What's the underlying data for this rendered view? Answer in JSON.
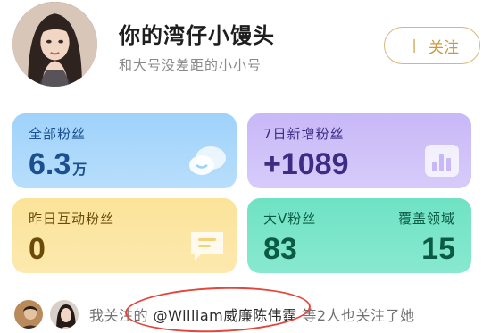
{
  "profile": {
    "name": "你的湾仔小馒头",
    "bio": "和大号没差距的小小号",
    "avatar_icon": "user-avatar"
  },
  "follow_button": {
    "label": "关注",
    "icon": "plus-icon"
  },
  "stats": {
    "all_fans": {
      "label": "全部粉丝",
      "value": "6.3",
      "unit": "万",
      "icon": "chat-bubbles-icon"
    },
    "new_fans_7d": {
      "label": "7日新增粉丝",
      "value": "+1089",
      "icon": "bar-chart-icon"
    },
    "yesterday_interactive": {
      "label": "昨日互动粉丝",
      "value": "0",
      "icon": "message-icon"
    },
    "bigv_fans": {
      "label": "大V粉丝",
      "value": "83",
      "label2": "覆盖领域",
      "value2": "15"
    }
  },
  "mutual": {
    "prefix": "我关注的",
    "user": "@William威廉陈伟霆",
    "suffix": "等2人也关注了她"
  },
  "colors": {
    "accent_gold": "#c89a3e",
    "annotation_red": "#e3463b"
  }
}
